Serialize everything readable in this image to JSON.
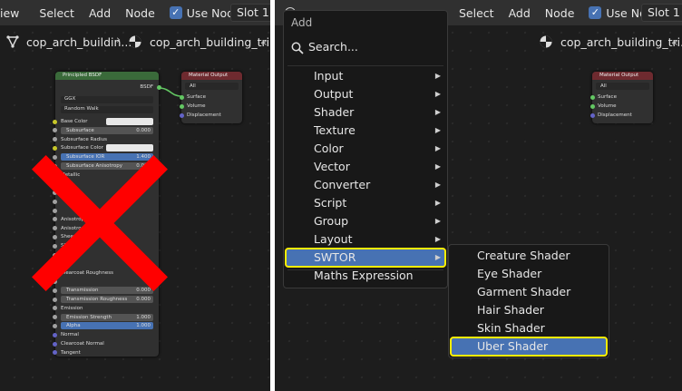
{
  "left": {
    "header": {
      "menu_view": "iew",
      "menu_select": "Select",
      "menu_add": "Add",
      "menu_node": "Node",
      "use_nodes": "Use Nodes",
      "slot": "Slot 1"
    },
    "breadcrumb": {
      "object": "cop_arch_buildin...",
      "material": "cop_arch_building_tri...",
      "more": "«"
    },
    "principled": {
      "title": "Principled BSDF",
      "output": "BSDF",
      "distribution": "GGX",
      "subsurface_method": "Random Walk",
      "rows": [
        {
          "label": "Base Color"
        },
        {
          "label": "Subsurface",
          "value": "0.000"
        },
        {
          "label": "Subsurface Radius"
        },
        {
          "label": "Subsurface Color"
        },
        {
          "label": "Subsurface IOR",
          "value": "1.400"
        },
        {
          "label": "Subsurface Anisotropy",
          "value": "0.000"
        },
        {
          "label": "Metallic"
        },
        {
          "label": ""
        },
        {
          "label": ""
        },
        {
          "label": ""
        },
        {
          "label": ""
        },
        {
          "label": "Anisotropic"
        },
        {
          "label": "Anisotropic"
        },
        {
          "label": "Sheen"
        },
        {
          "label": "Sheen"
        },
        {
          "label": ""
        },
        {
          "label": ""
        },
        {
          "label": "Clearcoat Roughness"
        },
        {
          "label": ""
        },
        {
          "label": "Transmission",
          "value": "0.000"
        },
        {
          "label": "Transmission Roughness",
          "value": "0.000"
        },
        {
          "label": "Emission"
        },
        {
          "label": "Emission Strength",
          "value": "1.000"
        },
        {
          "label": "Alpha",
          "value": "1.000"
        },
        {
          "label": "Normal"
        },
        {
          "label": "Clearcoat Normal"
        },
        {
          "label": "Tangent"
        }
      ]
    },
    "material_output": {
      "title": "Material Output",
      "target": "All",
      "surface": "Surface",
      "volume": "Volume",
      "displacement": "Displacement"
    }
  },
  "right": {
    "header": {
      "menu_select": "Select",
      "menu_add": "Add",
      "menu_node": "Node",
      "use_nodes": "Use Nodes",
      "slot": "Slot 1"
    },
    "breadcrumb": {
      "material": "cop_arch_building_tri...",
      "more": "«"
    },
    "material_output": {
      "title": "Material Output",
      "target": "All",
      "surface": "Surface",
      "volume": "Volume",
      "displacement": "Displacement"
    },
    "add_menu": {
      "title": "Add",
      "search_label": "Search...",
      "items": [
        {
          "label": "Input",
          "has_sub": true
        },
        {
          "label": "Output",
          "has_sub": true
        },
        {
          "label": "Shader",
          "has_sub": true
        },
        {
          "label": "Texture",
          "has_sub": true
        },
        {
          "label": "Color",
          "has_sub": true
        },
        {
          "label": "Vector",
          "has_sub": true
        },
        {
          "label": "Converter",
          "has_sub": true
        },
        {
          "label": "Script",
          "has_sub": true
        },
        {
          "label": "Group",
          "has_sub": true
        },
        {
          "label": "Layout",
          "has_sub": true
        },
        {
          "label": "SWTOR",
          "has_sub": true,
          "active": true
        },
        {
          "label": "Maths Expression",
          "has_sub": false
        }
      ],
      "arrow": "▶"
    },
    "swtor_menu": {
      "items": [
        {
          "label": "Creature Shader"
        },
        {
          "label": "Eye Shader"
        },
        {
          "label": "Garment Shader"
        },
        {
          "label": "Hair Shader"
        },
        {
          "label": "Skin Shader"
        },
        {
          "label": "Uber Shader",
          "active": true
        }
      ]
    }
  },
  "colors": {
    "accent": "#4772b3",
    "highlight": "#ffee00",
    "cross": "#ff0000",
    "shader_socket": "#63c763",
    "vector_socket": "#6363c7",
    "color_socket": "#c7c729",
    "float_socket": "#a1a1a1"
  }
}
